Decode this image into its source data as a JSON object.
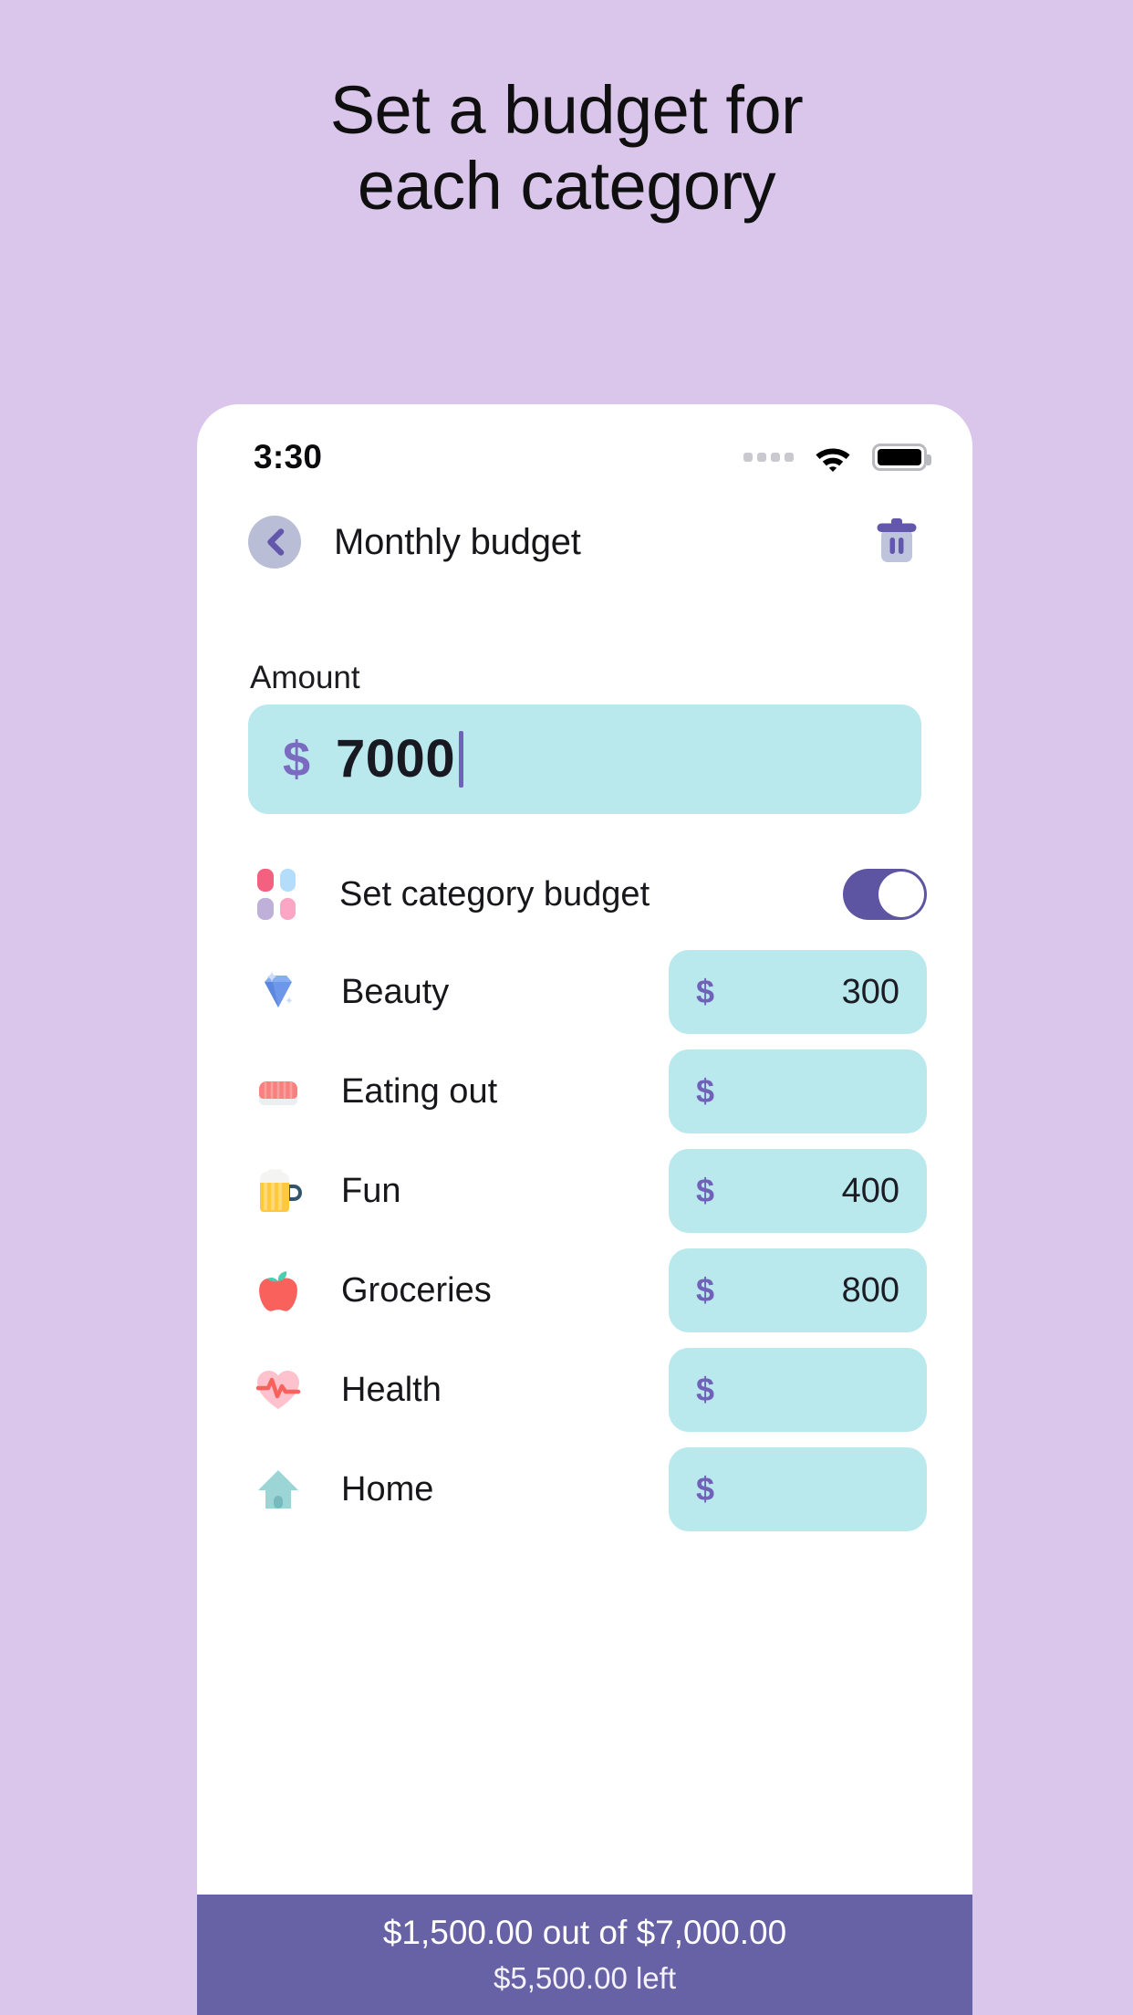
{
  "promo": {
    "headline_line1": "Set a budget for",
    "headline_line2": "each category",
    "bg_color": "#d9c6ea"
  },
  "status_bar": {
    "time": "3:30",
    "signal_icon": "signal-dots-icon",
    "wifi_icon": "wifi-icon",
    "battery_icon": "battery-full-icon"
  },
  "app_bar": {
    "back_icon": "chevron-left-icon",
    "title": "Monthly budget",
    "delete_icon": "trash-icon"
  },
  "amount": {
    "label": "Amount",
    "currency_symbol": "$",
    "value": "7000",
    "placeholder": "0",
    "field_color": "#b9e8ed"
  },
  "category_toggle": {
    "icon": "category-grid-icon",
    "label": "Set category budget",
    "enabled": true,
    "on_color": "#5e55a2",
    "tile_colors": [
      "#f4607f",
      "#b3ddfb",
      "#bfb0da",
      "#fba6c4"
    ]
  },
  "currency_symbol": "$",
  "categories": [
    {
      "icon": "gem-icon",
      "name": "Beauty",
      "amount": "300",
      "placeholder": ""
    },
    {
      "icon": "sushi-icon",
      "name": "Eating out",
      "amount": "",
      "placeholder": ""
    },
    {
      "icon": "beer-icon",
      "name": "Fun",
      "amount": "400",
      "placeholder": ""
    },
    {
      "icon": "apple-icon",
      "name": "Groceries",
      "amount": "800",
      "placeholder": ""
    },
    {
      "icon": "health-heart-icon",
      "name": "Health",
      "amount": "",
      "placeholder": ""
    },
    {
      "icon": "house-icon",
      "name": "Home",
      "amount": "",
      "placeholder": ""
    }
  ],
  "summary": {
    "spent_of_total": "$1,500.00 out of $7,000.00",
    "remaining": "$5,500.00 left",
    "bar_color": "#6762a5"
  }
}
